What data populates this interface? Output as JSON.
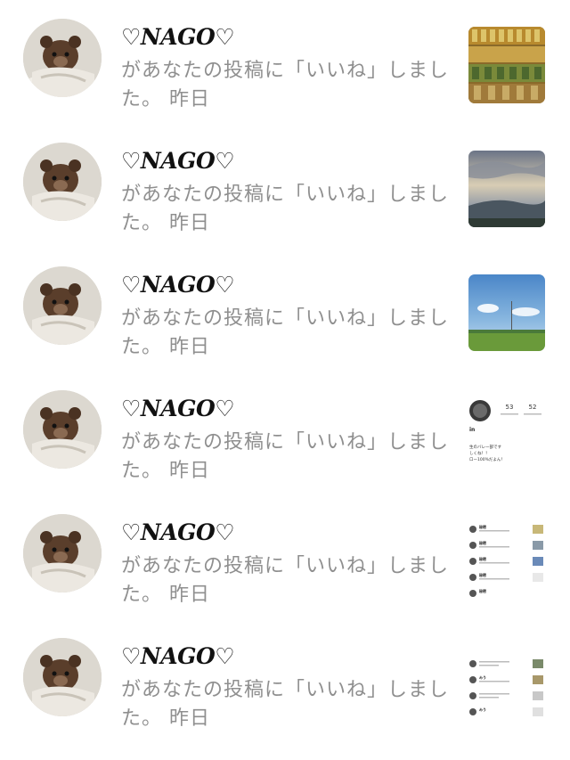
{
  "notifications": [
    {
      "user": "♡NAGO♡",
      "message": "があなたの投稿に「いいね」しました。",
      "time": "昨日",
      "thumb": "shelf-cans"
    },
    {
      "user": "♡NAGO♡",
      "message": "があなたの投稿に「いいね」しました。",
      "time": "昨日",
      "thumb": "sunset-sky"
    },
    {
      "user": "♡NAGO♡",
      "message": "があなたの投稿に「いいね」しました。",
      "time": "昨日",
      "thumb": "blue-sky-field"
    },
    {
      "user": "♡NAGO♡",
      "message": "があなたの投稿に「いいね」しました。",
      "time": "昨日",
      "thumb": "profile-screenshot",
      "thumb_text": {
        "stat1": "53",
        "stat2": "52",
        "name": "in",
        "line1": "生のバレー部です",
        "line2": "しくね！！",
        "line3": "ロー100%だよん！"
      }
    },
    {
      "user": "♡NAGO♡",
      "message": "があなたの投稿に「いいね」しました。",
      "time": "昨日",
      "thumb": "notifications-screenshot",
      "thumb_text": {
        "label": "秘密"
      }
    },
    {
      "user": "♡NAGO♡",
      "message": "があなたの投稿に「いいね」しました。",
      "time": "昨日",
      "thumb": "notifications-screenshot-2",
      "thumb_text": {
        "label": "みう"
      }
    }
  ]
}
